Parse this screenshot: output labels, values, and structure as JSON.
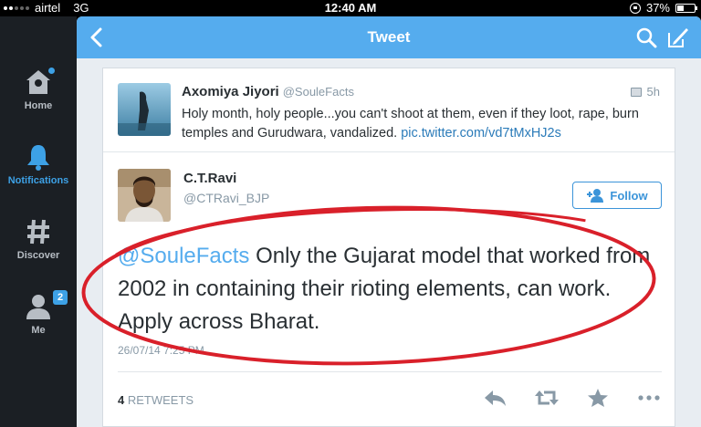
{
  "status_bar": {
    "carrier": "airtel",
    "network": "3G",
    "time": "12:40 AM",
    "battery_text": "37%",
    "battery_level": 0.37
  },
  "sidebar": {
    "items": [
      {
        "label": "Home",
        "icon": "home-icon"
      },
      {
        "label": "Notifications",
        "icon": "bell-icon",
        "active": true
      },
      {
        "label": "Discover",
        "icon": "hash-icon"
      },
      {
        "label": "Me",
        "icon": "person-icon",
        "badge": "2"
      }
    ]
  },
  "nav": {
    "title": "Tweet"
  },
  "quoted_tweet": {
    "name": "Axomiya Jiyori",
    "handle": "@SouleFacts",
    "time": "5h",
    "text": "Holy month, holy people...you can't shoot at them, even if they loot, rape, burn temples and Gurudwara, vandalized.",
    "link": "pic.twitter.com/vd7tMxHJ2s"
  },
  "tweet": {
    "author_name": "C.T.Ravi",
    "author_handle": "@CTRavi_BJP",
    "follow_label": "Follow",
    "mention": "@SouleFacts",
    "text": " Only the Gujarat model that worked from 2002 in containing their rioting elements, can work. Apply across Bharat.",
    "date": "26/07/14 7:25 PM",
    "retweet_count": "4",
    "retweet_label": "RETWEETS"
  },
  "colors": {
    "accent": "#55acee",
    "annotation": "#d9202a",
    "sidebar_bg": "#1b1f24"
  }
}
